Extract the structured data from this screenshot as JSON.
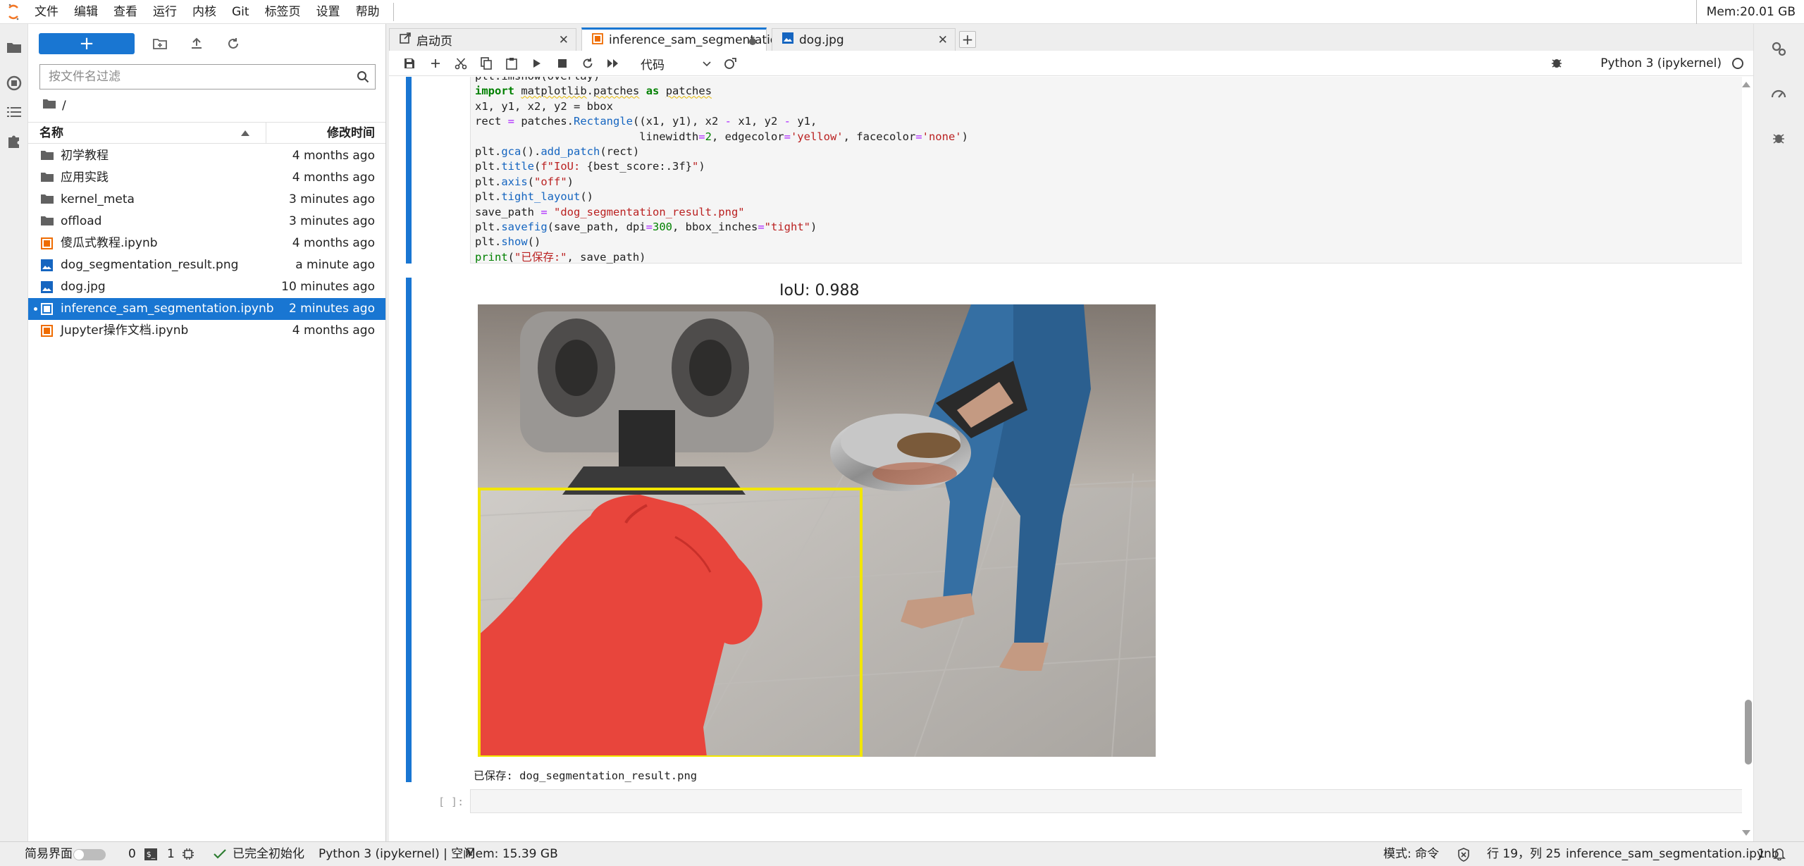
{
  "menubar": {
    "items": [
      "文件",
      "编辑",
      "查看",
      "运行",
      "内核",
      "Git",
      "标签页",
      "设置",
      "帮助"
    ],
    "memory": "Mem:20.01 GB"
  },
  "filebrowser": {
    "new_label": "+",
    "filter_placeholder": "按文件名过滤",
    "breadcrumb": "/",
    "col_name": "名称",
    "col_modified": "修改时间",
    "items": [
      {
        "name": "初学教程",
        "modified": "4 months ago",
        "type": "folder"
      },
      {
        "name": "应用实践",
        "modified": "4 months ago",
        "type": "folder"
      },
      {
        "name": "kernel_meta",
        "modified": "3 minutes ago",
        "type": "folder"
      },
      {
        "name": "offload",
        "modified": "3 minutes ago",
        "type": "folder"
      },
      {
        "name": "傻瓜式教程.ipynb",
        "modified": "4 months ago",
        "type": "notebook"
      },
      {
        "name": "dog_segmentation_result.png",
        "modified": "a minute ago",
        "type": "image"
      },
      {
        "name": "dog.jpg",
        "modified": "10 minutes ago",
        "type": "image"
      },
      {
        "name": "inference_sam_segmentation.ipynb",
        "modified": "2 minutes ago",
        "type": "notebook",
        "selected": true
      },
      {
        "name": "Jupyter操作文档.ipynb",
        "modified": "4 months ago",
        "type": "notebook"
      }
    ]
  },
  "tabs": [
    {
      "label": "启动页",
      "icon": "launcher-icon"
    },
    {
      "label": "inference_sam_segmentation",
      "icon": "notebook-icon",
      "active": true,
      "dirty": true
    },
    {
      "label": "dog.jpg",
      "icon": "image-icon"
    }
  ],
  "toolbar": {
    "cell_type": "代码",
    "kernel": "Python 3 (ipykernel)"
  },
  "code_lines": [
    "plt.imshow(overlay)",
    "import matplotlib.patches as patches",
    "x1, y1, x2, y2 = bbox",
    "rect = patches.Rectangle((x1, y1), x2 - x1, y2 - y1,",
    "                         linewidth=2, edgecolor='yellow', facecolor='none')",
    "plt.gca().add_patch(rect)",
    "plt.title(f\"IoU: {best_score:.3f}\")",
    "plt.axis(\"off\")",
    "plt.tight_layout()",
    "save_path = \"dog_segmentation_result.png\"",
    "plt.savefig(save_path, dpi=300, bbox_inches=\"tight\")",
    "plt.show()",
    "print(\"已保存:\", save_path)"
  ],
  "output": {
    "plot_title": "IoU: 0.988",
    "saved_text": "已保存: dog_segmentation_result.png",
    "box_color": "#f2e600",
    "mask_color": "#e8453c"
  },
  "empty_cell_prompt": "[ ]:",
  "statusbar": {
    "simple_mode": "简易界面",
    "terminals": "0",
    "kernels": "1",
    "init_status": "已完全初始化",
    "kernel_status": "Python 3 (ipykernel) | 空闲",
    "memory": "Mem: 15.39 GB",
    "mode": "模式: 命令",
    "cursor": "行 19，列 25",
    "filename": "inference_sam_segmentation.ipynb",
    "notifications": "1"
  },
  "colors": {
    "accent": "#1976d2",
    "menu_bg": "#ffffff",
    "panel_bg": "#eeeeee"
  }
}
